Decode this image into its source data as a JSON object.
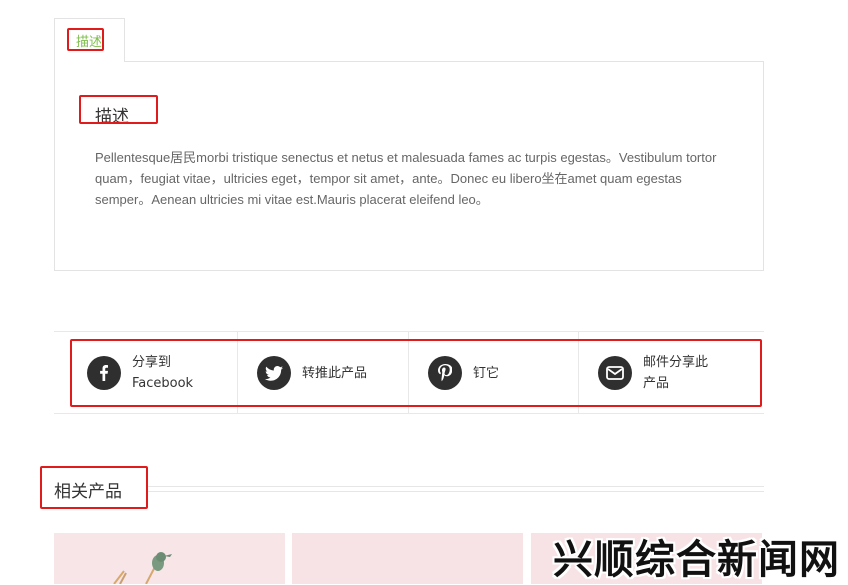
{
  "tabs": [
    {
      "label": "描述",
      "active": true
    }
  ],
  "description": {
    "title": "描述",
    "text": "Pellentesque居民morbi tristique senectus et netus et malesuada fames ac turpis egestas。Vestibulum tortor quam，feugiat vitae，ultricies eget，tempor sit amet，ante。Donec eu libero坐在amet quam egestas semper。Aenean ultricies mi vitae est.Mauris placerat eleifend leo。"
  },
  "share": [
    {
      "label": "分享到 Facebook",
      "icon": "facebook-icon"
    },
    {
      "label": "转推此产品",
      "icon": "twitter-icon"
    },
    {
      "label": "钉它",
      "icon": "pinterest-icon"
    },
    {
      "label": "邮件分享此产品",
      "icon": "mail-icon"
    }
  ],
  "related": {
    "title": "相关产品"
  },
  "watermark": "兴顺综合新闻网",
  "colors": {
    "tab_active": "#7fbf4d",
    "highlight_box": "#e01b1b",
    "icon_bg": "#2f2f2f",
    "thumb_bg": "#f7e3e6"
  }
}
